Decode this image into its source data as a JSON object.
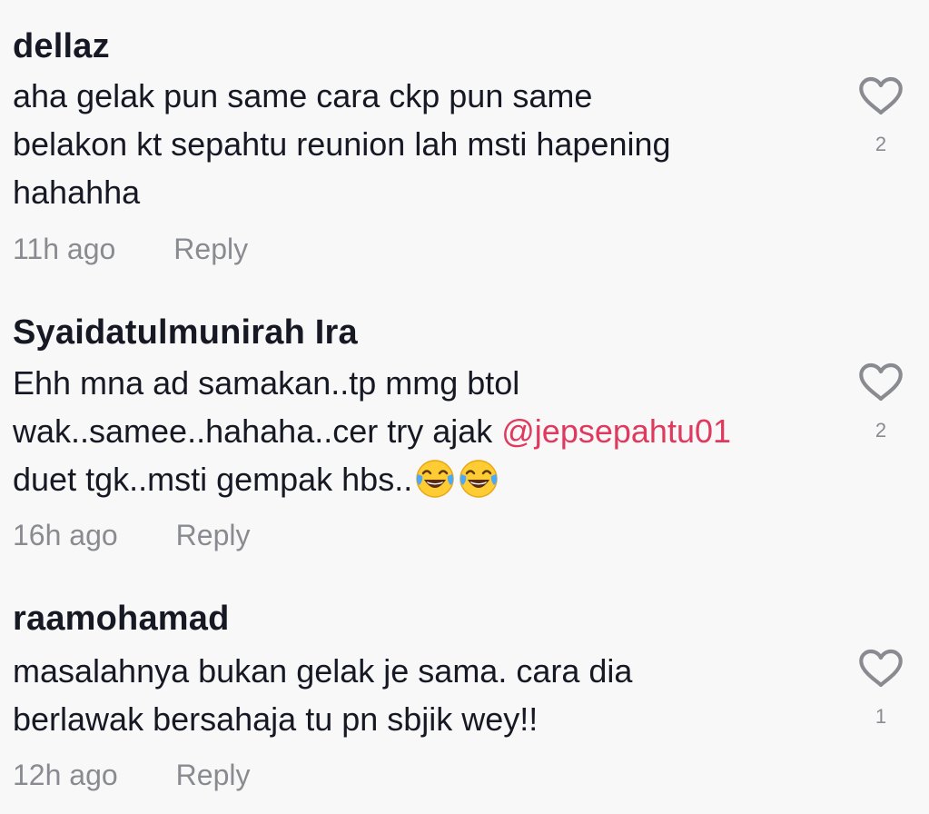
{
  "colors": {
    "background": "#f8f8f8",
    "text": "#161823",
    "muted": "#8a8b91",
    "mention": "#e0395e"
  },
  "comments": [
    {
      "username": "dellaz",
      "lines": [
        "aha gelak pun same cara ckp pun same",
        "belakon kt sepahtu reunion lah msti hapening",
        "hahahha"
      ],
      "time": "11h ago",
      "reply_label": "Reply",
      "like_icon": "heart-outline-icon",
      "like_count": "2"
    },
    {
      "username": "Syaidatulmunirah Ira",
      "line1": "Ehh mna ad samakan..tp mmg btol",
      "line2_prefix": "wak..samee..hahaha..cer try ajak ",
      "mention": "@jepsepahtu01",
      "line3": "duet tgk..msti gempak hbs..",
      "emojis": [
        "face-with-tears-of-joy-emoji",
        "face-with-tears-of-joy-emoji"
      ],
      "time": "16h ago",
      "reply_label": "Reply",
      "like_icon": "heart-outline-icon",
      "like_count": "2"
    },
    {
      "username": "raamohamad",
      "lines": [
        "masalahnya bukan gelak je sama. cara dia",
        "berlawak bersahaja tu pn sbjik wey!!"
      ],
      "time": "12h ago",
      "reply_label": "Reply",
      "like_icon": "heart-outline-icon",
      "like_count": "1"
    }
  ]
}
